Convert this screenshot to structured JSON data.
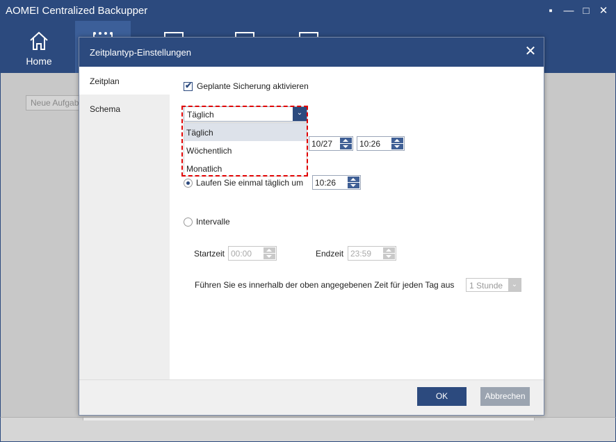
{
  "app": {
    "title": "AOMEI Centralized Backupper",
    "window_controls": [
      "▪",
      "—",
      "□",
      "✕"
    ],
    "nav_home_label": "Home",
    "search_placeholder": "Neue Aufgab"
  },
  "dialog": {
    "title": "Zeitplantyp-Einstellungen",
    "sidebar": [
      {
        "label": "Zeitplan",
        "active": true
      },
      {
        "label": "Schema",
        "active": false
      }
    ],
    "enable_checkbox_label": "Geplante Sicherung aktivieren",
    "enable_checked": true,
    "frequency": {
      "selected": "Täglich",
      "options": [
        "Täglich",
        "Wöchentlich",
        "Monatlich"
      ]
    },
    "date_value": "10/27",
    "time_value": "10:26",
    "once_daily": {
      "label": "Laufen Sie einmal täglich um",
      "time": "10:26",
      "selected": true
    },
    "interval": {
      "label": "Intervalle",
      "selected": false,
      "start_label": "Startzeit",
      "start_value": "00:00",
      "end_label": "Endzeit",
      "end_value": "23:59",
      "repeat_label": "Führen Sie es innerhalb der oben angegebenen Zeit für jeden Tag aus",
      "repeat_value": "1 Stunde"
    },
    "ok_label": "OK",
    "cancel_label": "Abbrechen"
  },
  "colors": {
    "brand_blue": "#2c4a7e",
    "highlight_red": "#e00000"
  }
}
